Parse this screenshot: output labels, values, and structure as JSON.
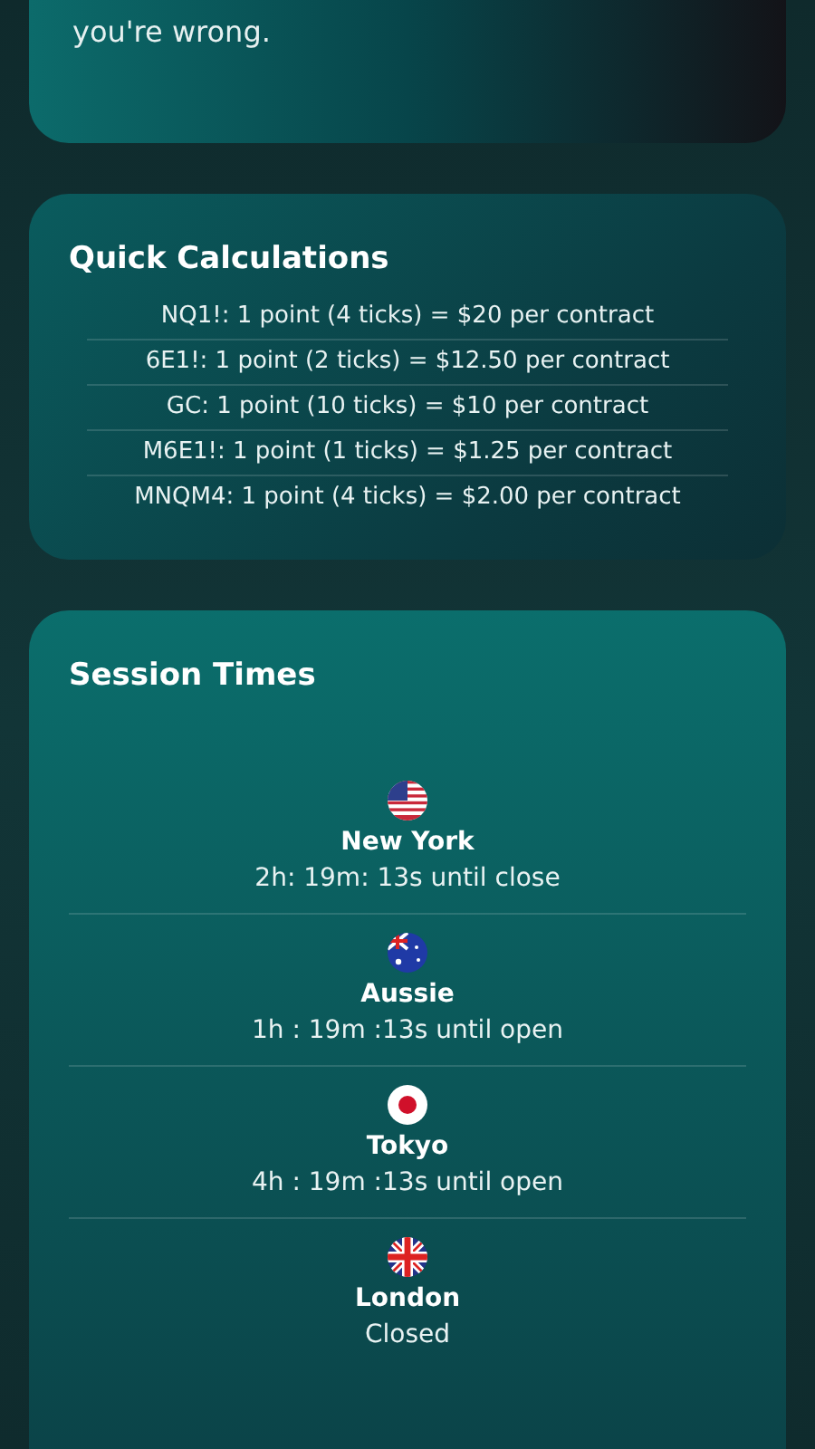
{
  "intro_card": {
    "text": "you're wrong."
  },
  "quick_calculations": {
    "title": "Quick Calculations",
    "rows": [
      "NQ1!: 1 point (4 ticks) = $20 per contract",
      "6E1!: 1 point (2 ticks) = $12.50 per contract",
      "GC: 1 point (10 ticks) = $10 per contract",
      "M6E1!: 1 point (1 ticks) = $1.25 per contract",
      "MNQM4: 1 point (4 ticks) = $2.00 per contract"
    ]
  },
  "session_times": {
    "title": "Session Times",
    "sessions": [
      {
        "kind": "us",
        "city": "New York",
        "status": "2h: 19m: 13s until close"
      },
      {
        "kind": "au",
        "city": "Aussie",
        "status": "1h : 19m :13s until open"
      },
      {
        "kind": "jp",
        "city": "Tokyo",
        "status": "4h : 19m :13s until open"
      },
      {
        "kind": "gb",
        "city": "London",
        "status": "Closed"
      }
    ]
  }
}
